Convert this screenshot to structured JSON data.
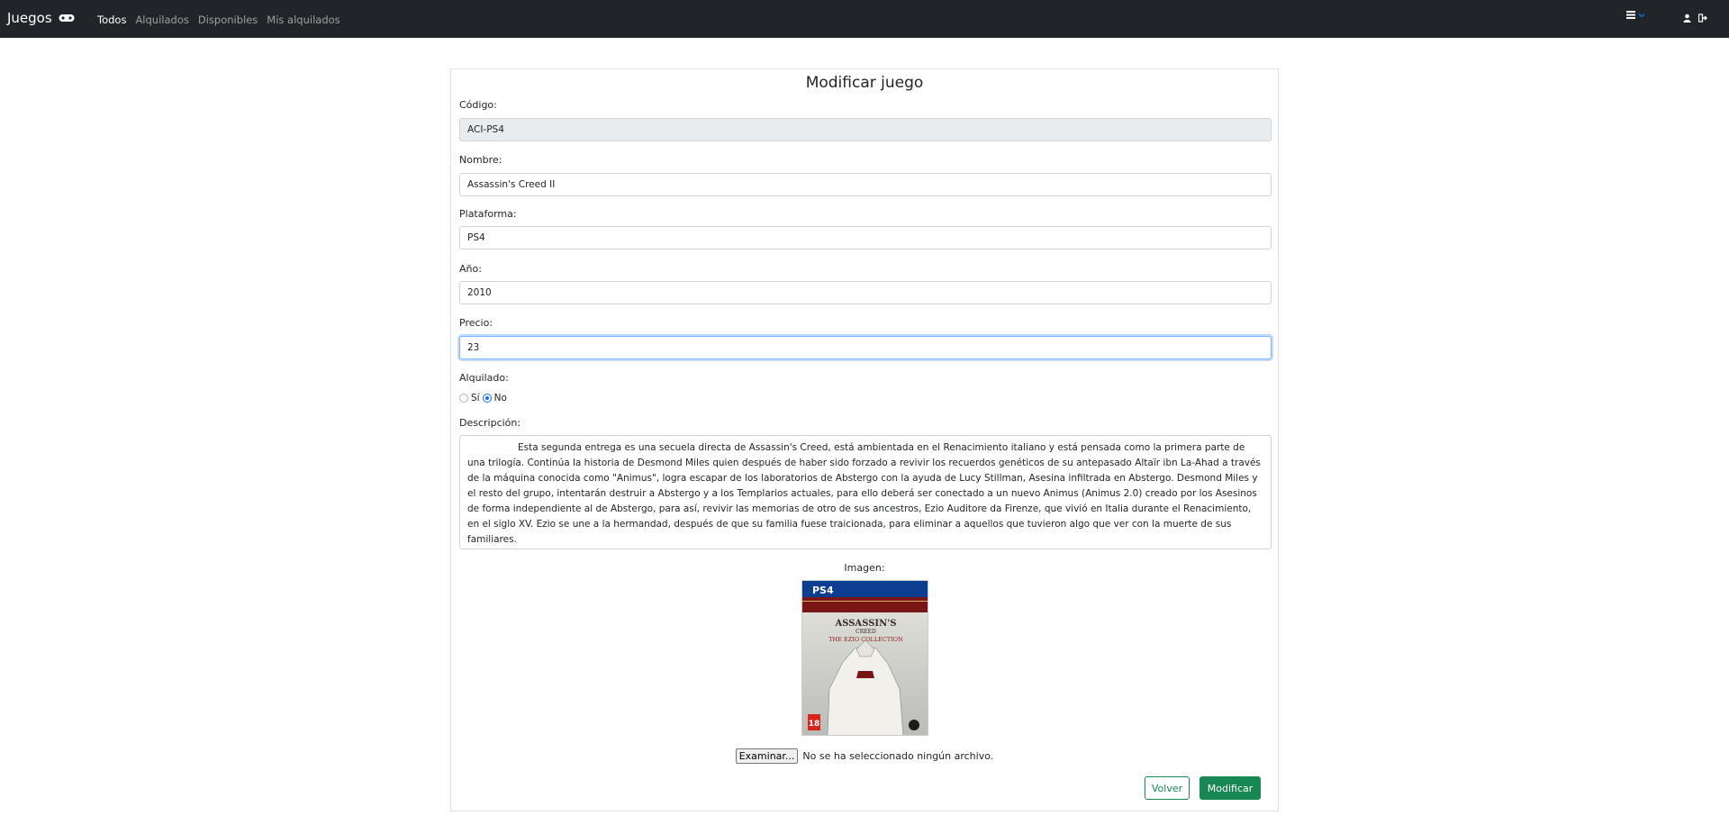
{
  "navbar": {
    "brand": "Juegos",
    "links": [
      "Todos",
      "Alquilados",
      "Disponibles",
      "Mis alquilados"
    ],
    "active_link": "Todos"
  },
  "form": {
    "title": "Modificar juego",
    "codigo_label": "Código:",
    "codigo_value": "ACI-PS4",
    "nombre_label": "Nombre:",
    "nombre_value": "Assassin's Creed II",
    "plataforma_label": "Plataforma:",
    "plataforma_value": "PS4",
    "anio_label": "Año:",
    "anio_value": "2010",
    "precio_label": "Precio:",
    "precio_value": "23",
    "alquilado_label": "Alquilado:",
    "alquilado_options": [
      "Sí",
      "No"
    ],
    "alquilado_selected": "No",
    "descripcion_label": "Descripción:",
    "descripcion_value": "Esta segunda entrega es una secuela directa de Assassin's Creed, está ambientada en el Renacimiento italiano y está pensada como la primera parte de una trilogía. Continúa la historia de Desmond Miles quien después de haber sido forzado a revivir los recuerdos genéticos de su antepasado Altaïr ibn La-Ahad a través de la máquina conocida como \"Animus\", logra escapar de los laboratorios de Abstergo con la ayuda de Lucy Stillman, Asesina infiltrada en Abstergo. Desmond Miles y el resto del grupo, intentarán destruir a Abstergo y a los Templarios actuales, para ello deberá ser conectado a un nuevo Animus (Animus 2.0) creado por los Asesinos de forma independiente al de Abstergo, para así, revivir las memorias de otro de sus ancestros, Ezio Auditore da Firenze, que vivió en Italia durante el Renacimiento, en el siglo XV. Ezio se une a la hermandad, después de que su familia fuese traicionada, para eliminar a aquellos que tuvieron algo que ver con la muerte de sus familiares.",
    "imagen_label": "Imagen:",
    "file_button": "Examinar...",
    "file_status": "No se ha seleccionado ningún archivo.",
    "back_button": "Volver",
    "submit_button": "Modificar"
  },
  "cover": {
    "platform": "PS4",
    "title": "ASSASSIN'S",
    "subtitle": "CREED",
    "collection": "THE EZIO COLLECTION",
    "rating": "18",
    "icon": "game-cover-image"
  },
  "colors": {
    "navbar": "#212529",
    "primary": "#0d6efd",
    "success": "#198754"
  }
}
